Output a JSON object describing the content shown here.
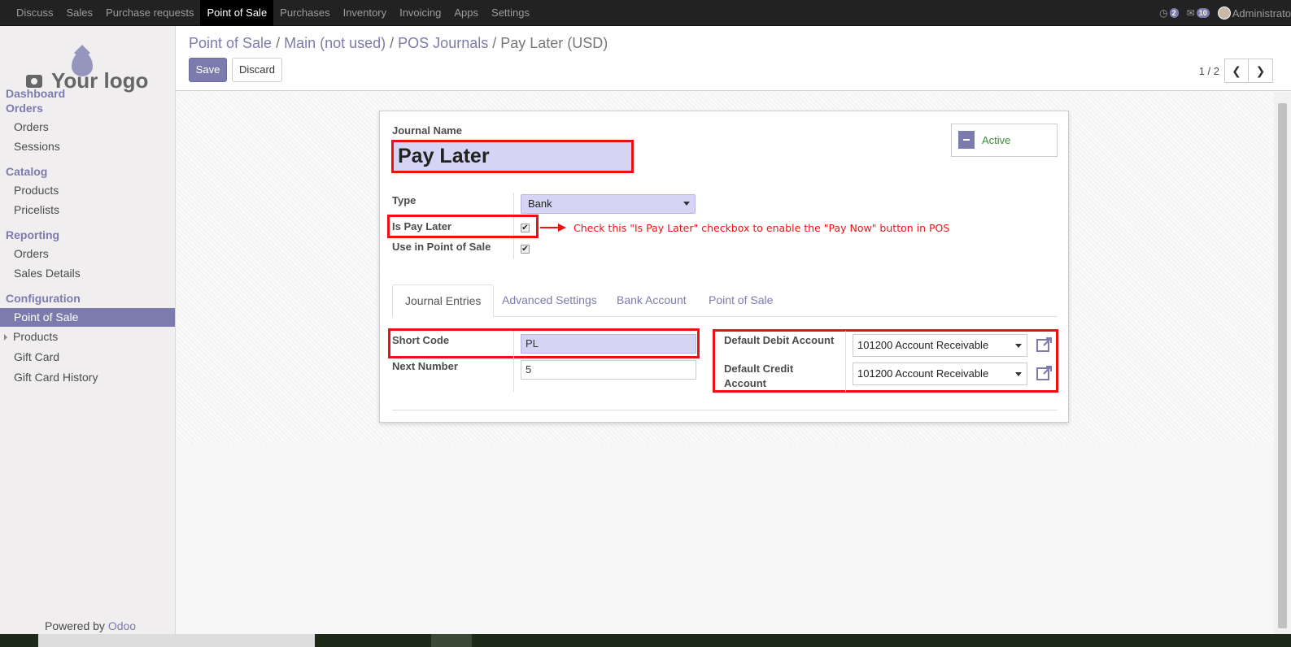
{
  "topbar": {
    "menu": [
      "Discuss",
      "Sales",
      "Purchase requests",
      "Point of Sale",
      "Purchases",
      "Inventory",
      "Invoicing",
      "Apps",
      "Settings"
    ],
    "active_menu": "Point of Sale",
    "chat_count": "2",
    "message_count": "10",
    "user": "Administrato"
  },
  "sidebar": {
    "logo_text": "Your logo",
    "sections": [
      {
        "title": "Dashboard"
      },
      {
        "title": "Orders",
        "items": [
          "Orders",
          "Sessions"
        ]
      },
      {
        "title": "Catalog",
        "items": [
          "Products",
          "Pricelists"
        ]
      },
      {
        "title": "Reporting",
        "items": [
          "Orders",
          "Sales Details"
        ]
      },
      {
        "title": "Configuration",
        "items": [
          "Point of Sale",
          "Products",
          "Gift Card",
          "Gift Card History"
        ]
      }
    ],
    "selected": "Point of Sale",
    "powered_by": "Powered by",
    "powered_brand": "Odoo"
  },
  "control_panel": {
    "breadcrumb": [
      "Point of Sale",
      "Main (not used)",
      "POS Journals"
    ],
    "breadcrumb_sep": "/",
    "current": "Pay Later (USD)",
    "save_label": "Save",
    "discard_label": "Discard",
    "pager": "1 / 2"
  },
  "form": {
    "journal_name_label": "Journal Name",
    "journal_name": "Pay Later",
    "active_label": "Active",
    "type_label": "Type",
    "type_value": "Bank",
    "is_pay_later_label": "Is Pay Later",
    "is_pay_later_checked": true,
    "use_in_pos_label": "Use in Point of Sale",
    "use_in_pos_checked": true,
    "annotation": "Check this \"Is Pay Later\" checkbox to enable the \"Pay Now\" button in POS",
    "tabs": [
      "Journal Entries",
      "Advanced Settings",
      "Bank Account",
      "Point of Sale"
    ],
    "active_tab": "Journal Entries",
    "short_code_label": "Short Code",
    "short_code": "PL",
    "next_number_label": "Next Number",
    "next_number": "5",
    "default_debit_label": "Default Debit Account",
    "default_debit_value": "101200 Account Receivable",
    "default_credit_label": "Default Credit Account",
    "default_credit_value": "101200 Account Receivable"
  },
  "colors": {
    "accent": "#7c7bad",
    "highlight": "#ee1111"
  }
}
